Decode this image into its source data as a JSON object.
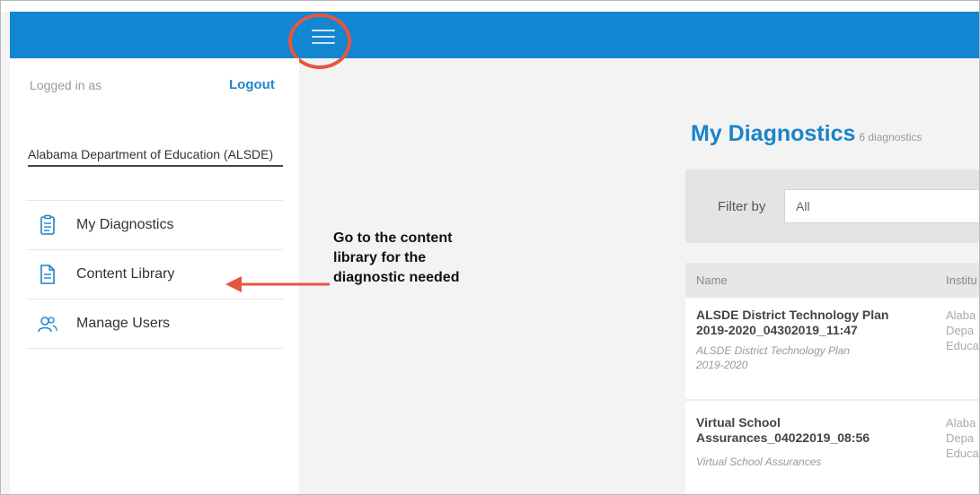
{
  "header": {
    "menu_icon": "hamburger-menu-icon"
  },
  "sidebar": {
    "logged_in_label": "Logged in as",
    "logout_label": "Logout",
    "organization": "Alabama Department of Education (ALSDE)",
    "items": [
      {
        "label": "My Diagnostics",
        "icon": "clipboard-icon"
      },
      {
        "label": "Content Library",
        "icon": "document-icon"
      },
      {
        "label": "Manage Users",
        "icon": "users-icon"
      }
    ]
  },
  "annotation": {
    "line1": "Go to the content",
    "line2": "library for the",
    "line3": "diagnostic needed"
  },
  "main": {
    "title": "My Diagnostics",
    "count": "6 diagnostics",
    "filter_label": "Filter by",
    "filter_value": "All",
    "columns": [
      "Name",
      "Institu"
    ],
    "rows": [
      {
        "name_line1": "ALSDE District Technology Plan",
        "name_line2": "2019-2020_04302019_11:47",
        "sub_line1": "ALSDE District Technology Plan",
        "sub_line2": "2019-2020",
        "inst_line1": "Alaba",
        "inst_line2": "Depa",
        "inst_line3": "Educa"
      },
      {
        "name_line1": "Virtual School",
        "name_line2": "Assurances_04022019_08:56",
        "sub_line1": "Virtual School Assurances",
        "inst_line1": "Alaba",
        "inst_line2": "Depa",
        "inst_line3": "Educa"
      }
    ]
  },
  "colors": {
    "brand": "#1286d1",
    "accent": "#1a84c9",
    "highlight": "#e8553f"
  }
}
